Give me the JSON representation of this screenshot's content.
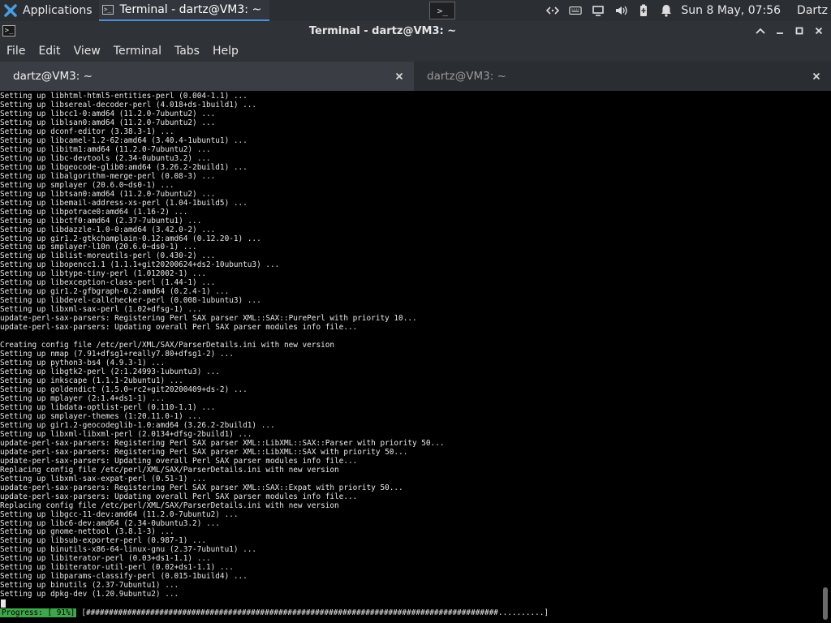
{
  "panel": {
    "applications_label": "Applications",
    "task_title": "Terminal - dartz@VM3: ~",
    "clock": "Sun  8 May, 07:56",
    "user": "Dartz"
  },
  "window": {
    "title": "Terminal - dartz@VM3: ~"
  },
  "menu": [
    "File",
    "Edit",
    "View",
    "Terminal",
    "Tabs",
    "Help"
  ],
  "tabs": [
    {
      "label": "dartz@VM3: ~",
      "active": true
    },
    {
      "label": "dartz@VM3: ~",
      "active": false
    }
  ],
  "terminal": {
    "lines": [
      "Setting up libhtml-html5-entities-perl (0.004-1.1) ...",
      "Setting up libsereal-decoder-perl (4.018+ds-1build1) ...",
      "Setting up libcc1-0:amd64 (11.2.0-7ubuntu2) ...",
      "Setting up liblsan0:amd64 (11.2.0-7ubuntu2) ...",
      "Setting up dconf-editor (3.38.3-1) ...",
      "Setting up libcamel-1.2-62:amd64 (3.40.4-1ubuntu1) ...",
      "Setting up libitm1:amd64 (11.2.0-7ubuntu2) ...",
      "Setting up libc-devtools (2.34-0ubuntu3.2) ...",
      "Setting up libgeocode-glib0:amd64 (3.26.2-2build1) ...",
      "Setting up libalgorithm-merge-perl (0.08-3) ...",
      "Setting up smplayer (20.6.0~ds0-1) ...",
      "Setting up libtsan0:amd64 (11.2.0-7ubuntu2) ...",
      "Setting up libemail-address-xs-perl (1.04-1build5) ...",
      "Setting up libpotrace0:amd64 (1.16-2) ...",
      "Setting up libctf0:amd64 (2.37-7ubuntu1) ...",
      "Setting up libdazzle-1.0-0:amd64 (3.42.0-2) ...",
      "Setting up gir1.2-gtkchamplain-0.12:amd64 (0.12.20-1) ...",
      "Setting up smplayer-l10n (20.6.0~ds0-1) ...",
      "Setting up liblist-moreutils-perl (0.430-2) ...",
      "Setting up libopencc1.1 (1.1.1+git20200624+ds2-10ubuntu3) ...",
      "Setting up libtype-tiny-perl (1.012002-1) ...",
      "Setting up libexception-class-perl (1.44-1) ...",
      "Setting up gir1.2-gfbgraph-0.2:amd64 (0.2.4-1) ...",
      "Setting up libdevel-callchecker-perl (0.008-1ubuntu3) ...",
      "Setting up libxml-sax-perl (1.02+dfsg-1) ...",
      "update-perl-sax-parsers: Registering Perl SAX parser XML::SAX::PurePerl with priority 10...",
      "update-perl-sax-parsers: Updating overall Perl SAX parser modules info file...",
      "",
      "Creating config file /etc/perl/XML/SAX/ParserDetails.ini with new version",
      "Setting up nmap (7.91+dfsg1+really7.80+dfsg1-2) ...",
      "Setting up python3-bs4 (4.9.3-1) ...",
      "Setting up libgtk2-perl (2:1.24993-1ubuntu3) ...",
      "Setting up inkscape (1.1.1-2ubuntu1) ...",
      "Setting up goldendict (1.5.0~rc2+git20200409+ds-2) ...",
      "Setting up mplayer (2:1.4+ds1-1) ...",
      "Setting up libdata-optlist-perl (0.110-1.1) ...",
      "Setting up smplayer-themes (1:20.11.0-1) ...",
      "Setting up gir1.2-geocodeglib-1.0:amd64 (3.26.2-2build1) ...",
      "Setting up libxml-libxml-perl (2.0134+dfsg-2build1) ...",
      "update-perl-sax-parsers: Registering Perl SAX parser XML::LibXML::SAX::Parser with priority 50...",
      "update-perl-sax-parsers: Registering Perl SAX parser XML::LibXML::SAX with priority 50...",
      "update-perl-sax-parsers: Updating overall Perl SAX parser modules info file...",
      "Replacing config file /etc/perl/XML/SAX/ParserDetails.ini with new version",
      "Setting up libxml-sax-expat-perl (0.51-1) ...",
      "update-perl-sax-parsers: Registering Perl SAX parser XML::SAX::Expat with priority 50...",
      "update-perl-sax-parsers: Updating overall Perl SAX parser modules info file...",
      "Replacing config file /etc/perl/XML/SAX/ParserDetails.ini with new version",
      "Setting up libgcc-11-dev:amd64 (11.2.0-7ubuntu2) ...",
      "Setting up libc6-dev:amd64 (2.34-0ubuntu3.2) ...",
      "Setting up gnome-nettool (3.8.1-3) ...",
      "Setting up libsub-exporter-perl (0.987-1) ...",
      "Setting up binutils-x86-64-linux-gnu (2.37-7ubuntu1) ...",
      "Setting up libiterator-perl (0.03+ds1-1.1) ...",
      "Setting up libiterator-util-perl (0.02+ds1-1.1) ...",
      "Setting up libparams-classify-perl (0.015-1build4) ...",
      "Setting up binutils (2.37-7ubuntu1) ...",
      "Setting up dpkg-dev (1.20.9ubuntu2) ..."
    ],
    "progress_label": "Progress: [ 91%]",
    "progress_bar": "[##########################################################################################..........]",
    "progress_percent": 91
  },
  "icons": {
    "app_menu": "xfce-x-icon",
    "launcher": "terminal-launcher-icon"
  },
  "colors": {
    "progress_green": "#3fa64b",
    "panel_bg": "#2b2e33",
    "task_accent": "#4a90d9"
  }
}
